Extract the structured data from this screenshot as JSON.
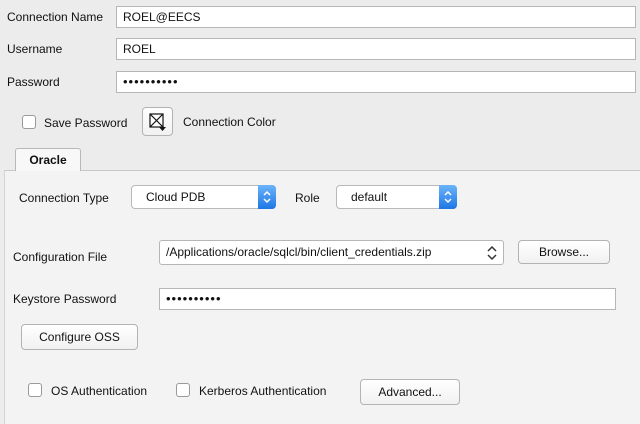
{
  "connection": {
    "name_label": "Connection Name",
    "name_value": "ROEL@EECS",
    "username_label": "Username",
    "username_value": "ROEL",
    "password_label": "Password",
    "password_value": "••••••••••",
    "save_password_label": "Save Password",
    "save_password_checked": false,
    "color_label": "Connection Color"
  },
  "tabs": [
    {
      "label": "Oracle",
      "active": true
    }
  ],
  "oracle": {
    "connection_type_label": "Connection Type",
    "connection_type_value": "Cloud PDB",
    "role_label": "Role",
    "role_value": "default",
    "config_file_label": "Configuration File",
    "config_file_value": "/Applications/oracle/sqlcl/bin/client_credentials.zip",
    "browse_label": "Browse...",
    "keystore_label": "Keystore Password",
    "keystore_value": "••••••••••",
    "configure_oss_label": "Configure OSS",
    "os_auth_label": "OS Authentication",
    "os_auth_checked": false,
    "kerberos_label": "Kerberos Authentication",
    "kerberos_checked": false,
    "advanced_label": "Advanced..."
  },
  "colors": {
    "background": "#ececec",
    "panel": "#f3f3f3",
    "select_accent": "#1d77e4"
  }
}
